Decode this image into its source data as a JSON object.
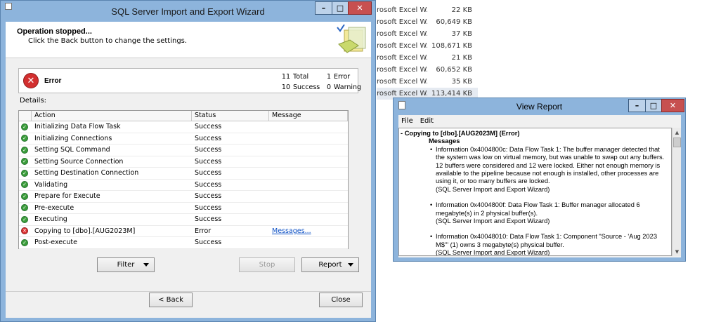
{
  "background_files": [
    {
      "name": "rosoft Excel W...",
      "size": "22 KB"
    },
    {
      "name": "rosoft Excel W...",
      "size": "60,649 KB"
    },
    {
      "name": "rosoft Excel W...",
      "size": "37 KB"
    },
    {
      "name": "rosoft Excel W...",
      "size": "108,671 KB"
    },
    {
      "name": "rosoft Excel W...",
      "size": "21 KB"
    },
    {
      "name": "rosoft Excel W...",
      "size": "60,652 KB"
    },
    {
      "name": "rosoft Excel W...",
      "size": "35 KB"
    },
    {
      "name": "rosoft Excel W...",
      "size": "113,414 KB"
    }
  ],
  "wizard": {
    "title": "SQL Server Import and Export Wizard",
    "titlebar_buttons": {
      "minimize": "–",
      "maximize": "□",
      "close": "✕"
    },
    "header": {
      "title": "Operation stopped...",
      "subtitle": "Click the Back button to change the settings."
    },
    "status": {
      "label": "Error",
      "total_count": "11",
      "total_label": "Total",
      "error_count": "1",
      "error_label": "Error",
      "success_count": "10",
      "success_label": "Success",
      "warning_count": "0",
      "warning_label": "Warning"
    },
    "details_label": "Details:",
    "grid": {
      "columns": {
        "action": "Action",
        "status": "Status",
        "message": "Message"
      },
      "rows": [
        {
          "action": "Initializing Data Flow Task",
          "status": "Success",
          "message": "",
          "state": "ok"
        },
        {
          "action": "Initializing Connections",
          "status": "Success",
          "message": "",
          "state": "ok"
        },
        {
          "action": "Setting SQL Command",
          "status": "Success",
          "message": "",
          "state": "ok"
        },
        {
          "action": "Setting Source Connection",
          "status": "Success",
          "message": "",
          "state": "ok"
        },
        {
          "action": "Setting Destination Connection",
          "status": "Success",
          "message": "",
          "state": "ok"
        },
        {
          "action": "Validating",
          "status": "Success",
          "message": "",
          "state": "ok"
        },
        {
          "action": "Prepare for Execute",
          "status": "Success",
          "message": "",
          "state": "ok"
        },
        {
          "action": "Pre-execute",
          "status": "Success",
          "message": "",
          "state": "ok"
        },
        {
          "action": "Executing",
          "status": "Success",
          "message": "",
          "state": "ok"
        },
        {
          "action": "Copying to [dbo].[AUG2023M]",
          "status": "Error",
          "message": "Messages...",
          "state": "error"
        },
        {
          "action": "Post-execute",
          "status": "Success",
          "message": "",
          "state": "ok"
        }
      ]
    },
    "buttons": {
      "filter": "Filter",
      "stop": "Stop",
      "report": "Report",
      "back": "< Back",
      "close": "Close"
    }
  },
  "report": {
    "title": "View Report",
    "titlebar_buttons": {
      "minimize": "–",
      "maximize": "□",
      "close": "✕"
    },
    "menu": [
      "File",
      "Edit"
    ],
    "heading": "Copying to [dbo].[AUG2023M] (Error)",
    "messages_label": "Messages",
    "items": [
      {
        "text": "Information 0x4004800c: Data Flow Task 1: The buffer manager detected that the system was low on virtual memory, but was unable to swap out any buffers. 12 buffers were considered and 12 were locked. Either not enough memory is available to the pipeline because not enough is installed, other processes are using it, or too many buffers are locked.",
        "source": "(SQL Server Import and Export Wizard)"
      },
      {
        "text": "Information 0x4004800f: Data Flow Task 1: Buffer manager allocated 6 megabyte(s) in 2 physical buffer(s).",
        "source": "(SQL Server Import and Export Wizard)"
      },
      {
        "text": "Information 0x40048010: Data Flow Task 1: Component \"Source - 'Aug 2023 M$'\" (1) owns 3 megabyte(s) physical buffer.",
        "source": "(SQL Server Import and Export Wizard)"
      }
    ]
  },
  "colors": {
    "window_frame": "#8db4dc",
    "error_red": "#d32f2f",
    "success_green": "#3a9d3a",
    "link_blue": "#0b4fc4"
  }
}
